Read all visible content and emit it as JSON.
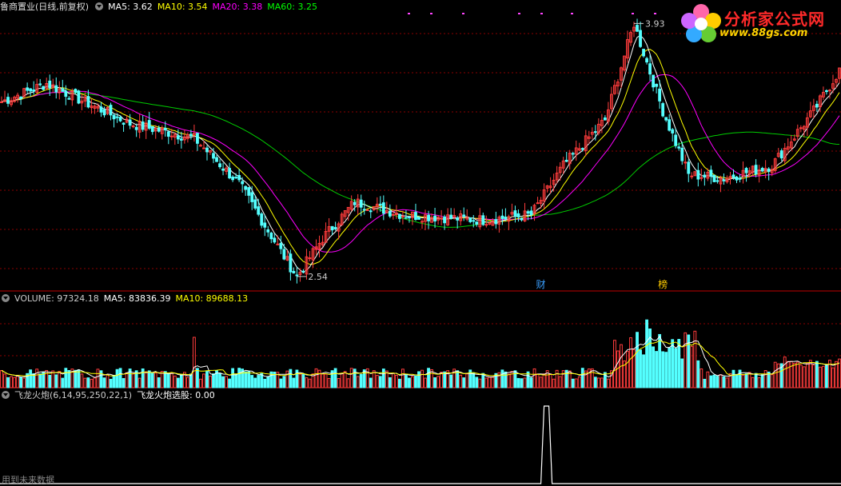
{
  "main": {
    "title": "鲁商置业(日线,前复权)",
    "ma_labels": [
      {
        "text": "MA5: 3.62",
        "color": "#ffffff"
      },
      {
        "text": "MA10: 3.54",
        "color": "#ffff00"
      },
      {
        "text": "MA20: 3.38",
        "color": "#ff00ff"
      },
      {
        "text": "MA60: 3.25",
        "color": "#00ff00"
      }
    ],
    "high_label": "3.93",
    "low_label": "2.54",
    "markers": [
      {
        "text": "财",
        "color": "#3aa0ff"
      },
      {
        "text": "榜",
        "color": "#ffcc00"
      }
    ]
  },
  "volume": {
    "labels": [
      {
        "text": "VOLUME: 97324.18",
        "color": "#cccccc"
      },
      {
        "text": "MA5: 83836.39",
        "color": "#ffffff"
      },
      {
        "text": "MA10: 89688.13",
        "color": "#ffff00"
      }
    ]
  },
  "indicator": {
    "labels": [
      {
        "text": "飞龙火炮(6,14,95,250,22,1)",
        "color": "#cccccc"
      },
      {
        "text": "飞龙火炮选股: 0.00",
        "color": "#ffffff"
      }
    ]
  },
  "footer_note": "用到未来数据",
  "logo": {
    "brand": "分析家公式网",
    "url": "www.88gs.com"
  },
  "colors": {
    "up": "#ff3c3c",
    "down": "#54ffff",
    "grid": "#8b0000"
  },
  "chart_data": {
    "type": "candlestick",
    "price_range": [
      2.54,
      3.93
    ],
    "key_points": {
      "start_close": 3.5,
      "early_peak": 3.6,
      "low": 2.54,
      "base_level": 2.85,
      "high": 3.93,
      "end_close": 3.7
    },
    "ma_values": {
      "MA5": 3.62,
      "MA10": 3.54,
      "MA20": 3.38,
      "MA60": 3.25
    },
    "volume": {
      "VOLUME": 97324.18,
      "MA5": 83836.39,
      "MA10": 89688.13
    },
    "indicator": {
      "name": "飞龙火炮",
      "params": [
        6,
        14,
        95,
        250,
        22,
        1
      ],
      "value": 0.0,
      "signal_count": 1
    }
  }
}
